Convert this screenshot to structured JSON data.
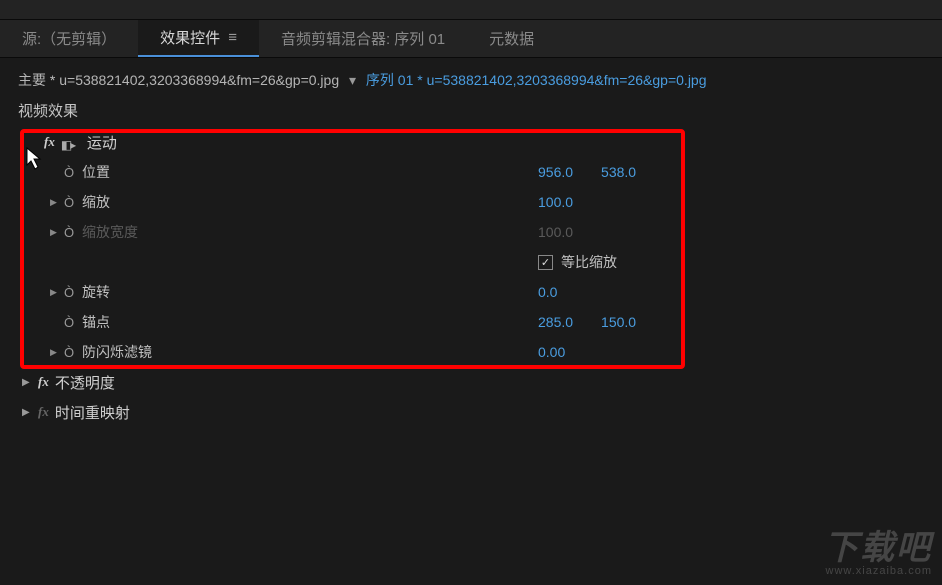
{
  "tabs": {
    "source": "源:（无剪辑）",
    "effect_controls": "效果控件",
    "audio_mixer": "音频剪辑混合器: 序列 01",
    "metadata": "元数据"
  },
  "breadcrumb": {
    "master_prefix": "主要",
    "star": "*",
    "master_name": "u=538821402,3203368994&fm=26&gp=0.jpg",
    "arrow": "▾",
    "seq_prefix": "序列 01",
    "seq_name": "u=538821402,3203368994&fm=26&gp=0.jpg"
  },
  "section": {
    "video_effects": "视频效果"
  },
  "effects": {
    "motion": {
      "label": "运动",
      "position": {
        "label": "位置",
        "x": "956.0",
        "y": "538.0"
      },
      "scale": {
        "label": "缩放",
        "value": "100.0"
      },
      "scale_width": {
        "label": "缩放宽度",
        "value": "100.0"
      },
      "uniform": {
        "label": "等比缩放",
        "checked": "✓"
      },
      "rotation": {
        "label": "旋转",
        "value": "0.0"
      },
      "anchor": {
        "label": "锚点",
        "x": "285.0",
        "y": "150.0"
      },
      "flicker": {
        "label": "防闪烁滤镜",
        "value": "0.00"
      }
    },
    "opacity": {
      "label": "不透明度"
    },
    "time_remap": {
      "label": "时间重映射"
    }
  },
  "watermark": {
    "big": "下载吧",
    "small": "www.xiazaiba.com"
  }
}
